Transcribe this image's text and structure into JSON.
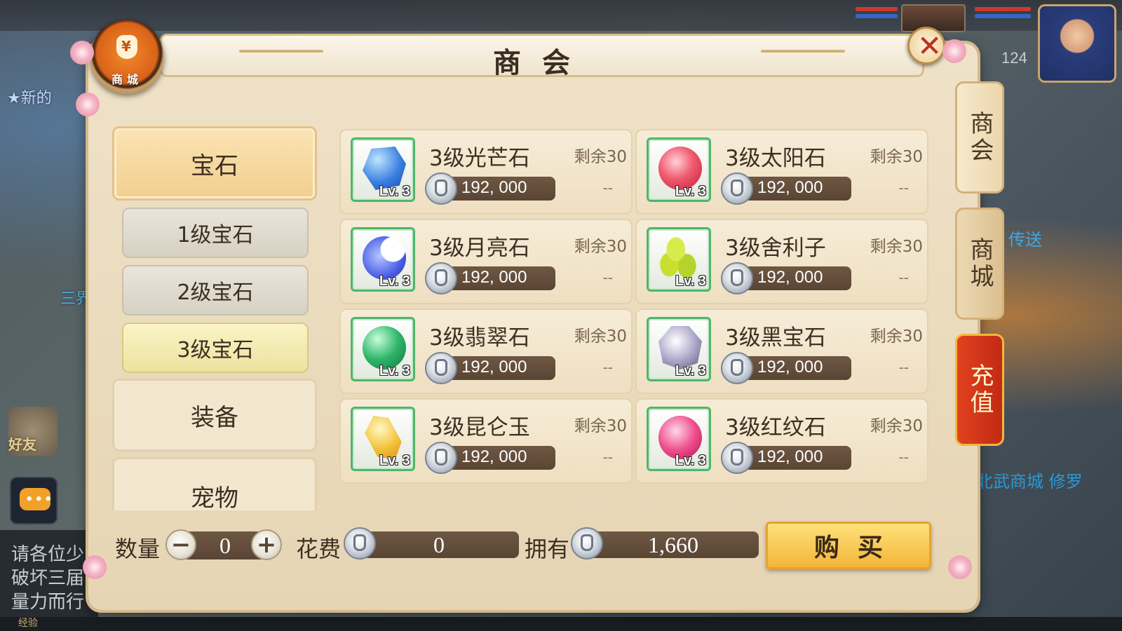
{
  "hud": {
    "player_level": "124",
    "left_text_1": "★新的",
    "left_text_2": "三界",
    "friend_label": "好友",
    "chat_lines": [
      "请各位少",
      "破坏三届",
      "量力而行"
    ],
    "exp_label": "经验",
    "right_text_1": "传送",
    "right_text_2": "北武商城 修罗"
  },
  "modal": {
    "title": "商会",
    "badge_label": "商城",
    "close_symbol": "✕"
  },
  "categories": {
    "gem": "宝石",
    "gem_sub": [
      "1级宝石",
      "2级宝石",
      "3级宝石"
    ],
    "equipment": "装备",
    "pet": "宠物",
    "selected_sub": "3级宝石"
  },
  "items": [
    {
      "name": "3级光芒石",
      "stock": "剩余30",
      "price": "192, 000",
      "limit": "--",
      "level": "Lv. 3",
      "icon": "blue-crystal-gem-icon"
    },
    {
      "name": "3级太阳石",
      "stock": "剩余30",
      "price": "192, 000",
      "limit": "--",
      "level": "Lv. 3",
      "icon": "red-sun-gem-icon"
    },
    {
      "name": "3级月亮石",
      "stock": "剩余30",
      "price": "192, 000",
      "limit": "--",
      "level": "Lv. 3",
      "icon": "blue-moon-gem-icon"
    },
    {
      "name": "3级舍利子",
      "stock": "剩余30",
      "price": "192, 000",
      "limit": "--",
      "level": "Lv. 3",
      "icon": "green-sarira-gem-icon"
    },
    {
      "name": "3级翡翠石",
      "stock": "剩余30",
      "price": "192, 000",
      "limit": "--",
      "level": "Lv. 3",
      "icon": "green-jade-gem-icon"
    },
    {
      "name": "3级黑宝石",
      "stock": "剩余30",
      "price": "192, 000",
      "limit": "--",
      "level": "Lv. 3",
      "icon": "black-diamond-gem-icon"
    },
    {
      "name": "3级昆仑玉",
      "stock": "剩余30",
      "price": "192, 000",
      "limit": "--",
      "level": "Lv. 3",
      "icon": "yellow-kunlun-jade-icon"
    },
    {
      "name": "3级红纹石",
      "stock": "剩余30",
      "price": "192, 000",
      "limit": "--",
      "level": "Lv. 3",
      "icon": "red-pattern-gem-icon"
    }
  ],
  "side_tabs": {
    "shanghui": "商会",
    "shangcheng": "商城",
    "recharge": "充值"
  },
  "purchase": {
    "quantity_label": "数量",
    "quantity": "0",
    "minus": "−",
    "plus": "+",
    "cost_label": "花费",
    "cost": "0",
    "own_label": "拥有",
    "own": "1,660",
    "buy_label": "购买"
  },
  "colors": {
    "panel_bg": "#efe2c8",
    "selected_gold": "#f2cf8d",
    "price_bar": "#5a4534",
    "buy_button": "#f2b63a",
    "recharge_red": "#c12a14"
  }
}
